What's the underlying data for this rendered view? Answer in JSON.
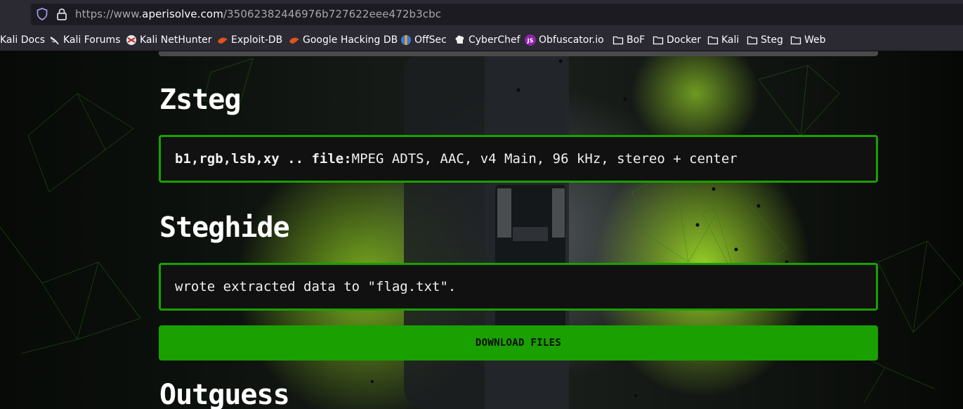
{
  "browser": {
    "url_prefix": "https://www.",
    "url_host": "aperisolve.com",
    "url_path": "/35062382446976b727622eee472b3cbc",
    "bookmarks": [
      {
        "label": "Kali Docs",
        "icon": "kali-icon"
      },
      {
        "label": "Kali Forums",
        "icon": "kali-dragon-icon"
      },
      {
        "label": "Kali NetHunter",
        "icon": "nethunter-icon"
      },
      {
        "label": "Exploit-DB",
        "icon": "exploit-db-icon"
      },
      {
        "label": "Google Hacking DB",
        "icon": "ghdb-icon"
      },
      {
        "label": "OffSec",
        "icon": "offsec-icon"
      },
      {
        "label": "CyberChef",
        "icon": "cyberchef-icon"
      },
      {
        "label": "Obfuscator.io",
        "icon": "js-icon"
      },
      {
        "label": "BoF",
        "icon": "folder-icon"
      },
      {
        "label": "Docker",
        "icon": "folder-icon"
      },
      {
        "label": "Kali",
        "icon": "folder-icon"
      },
      {
        "label": "Steg",
        "icon": "folder-icon"
      },
      {
        "label": "Web",
        "icon": "folder-icon"
      }
    ]
  },
  "sections": {
    "zsteg": {
      "title": "Zsteg",
      "result_key": "b1,rgb,lsb,xy .. file:",
      "result_value": " MPEG ADTS, AAC, v4 Main, 96 kHz, stereo + center"
    },
    "steghide": {
      "title": "Steghide",
      "result": "wrote extracted data to \"flag.txt\"."
    },
    "download_label": "DOWNLOAD FILES",
    "outguess": {
      "title": "Outguess"
    }
  },
  "colors": {
    "accent_green": "#1aa000",
    "box_background": "#111111",
    "chrome_background": "#2b2a33"
  }
}
